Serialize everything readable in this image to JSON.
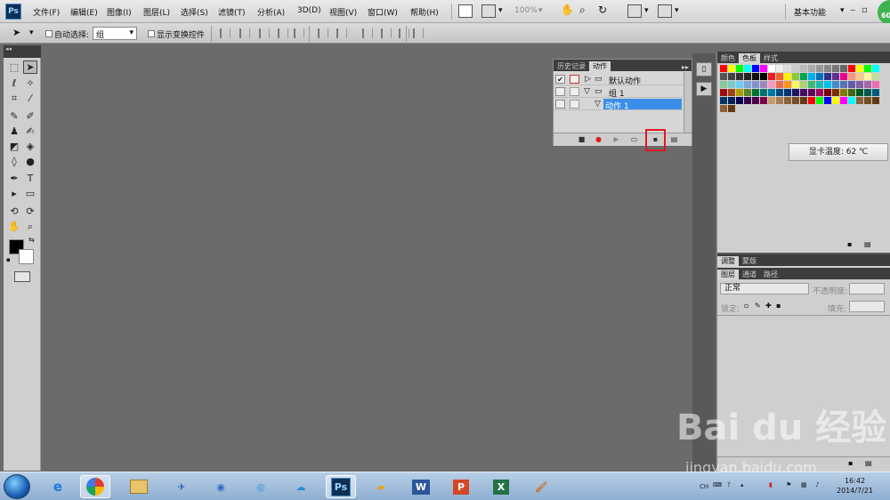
{
  "app": {
    "logo": "Ps",
    "workspace": "基本功能",
    "badge": "60"
  },
  "menu": [
    "文件(F)",
    "编辑(E)",
    "图像(I)",
    "图层(L)",
    "选择(S)",
    "滤镜(T)",
    "分析(A)",
    "3D(D)",
    "视图(V)",
    "窗口(W)",
    "帮助(H)"
  ],
  "zoom": "100%",
  "options": {
    "auto_select_label": "自动选择:",
    "auto_select_value": "组",
    "show_transform_label": "显示变换控件"
  },
  "actions_panel": {
    "tabs": [
      "历史记录",
      "动作"
    ],
    "rows": [
      {
        "label": "默认动作",
        "checked": true
      },
      {
        "label": "组 1",
        "checked": false
      },
      {
        "label": "动作 1",
        "checked": false,
        "selected": true
      }
    ]
  },
  "color_panel": {
    "tabs": [
      "颜色",
      "色板",
      "样式"
    ],
    "active_tab": "色板"
  },
  "tooltip": "显卡温度: 62 ℃",
  "adjust_panel": {
    "tabs": [
      "调整",
      "蒙版"
    ]
  },
  "layers_panel": {
    "tabs": [
      "图层",
      "通道",
      "路径"
    ],
    "blend_mode": "正常",
    "opacity_label": "不透明度:",
    "lock_label": "锁定:",
    "fill_label": "填充:"
  },
  "taskbar": {
    "apps": [
      "ie-icon",
      "chrome-icon",
      "explorer-icon",
      "feiq-icon",
      "chat-icon",
      "netdisk-icon",
      "cloud-icon",
      "Ps",
      "folder-icon",
      "W",
      "P",
      "X",
      "paint-icon"
    ],
    "lang": "CH",
    "time": "16:42",
    "date": "2014/7/21"
  },
  "watermark": {
    "brand": "Bai  du 经验",
    "url": "jingyan.baidu.com"
  }
}
